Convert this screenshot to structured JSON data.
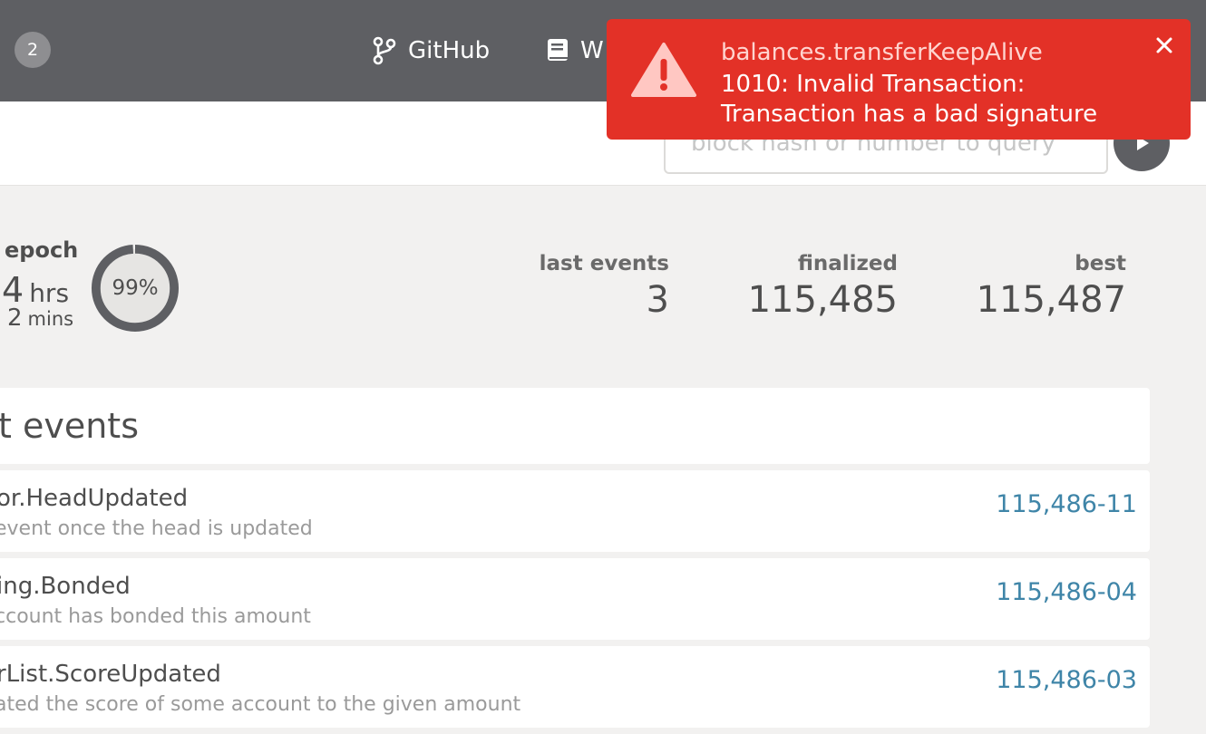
{
  "header": {
    "badge_count": "2",
    "nav": {
      "github_label": "GitHub",
      "wiki_label": "W"
    }
  },
  "query": {
    "placeholder": "block hash or number to query"
  },
  "summary": {
    "epoch": {
      "label": "epoch",
      "hours": "4",
      "hours_unit": "hrs",
      "minutes": "2",
      "minutes_unit": "mins",
      "progress_percent": 99,
      "progress_label": "99%"
    },
    "last_events": {
      "label": "last events",
      "value": "3"
    },
    "finalized": {
      "label": "finalized",
      "value": "115,485"
    },
    "best": {
      "label": "best",
      "value": "115,487"
    }
  },
  "events": {
    "title": "t events",
    "items": [
      {
        "name": "or.HeadUpdated",
        "description": "event once the head is updated",
        "block": "115,486-11"
      },
      {
        "name": "ing.Bonded",
        "description": "ccount has bonded this amount",
        "block": "115,486-04"
      },
      {
        "name": "rList.ScoreUpdated",
        "description": "ated the score of some account to the given amount",
        "block": "115,486-03"
      }
    ]
  },
  "toast": {
    "title": "balances.transferKeepAlive",
    "message_line1": "1010: Invalid Transaction:",
    "message_line2": "Transaction has a bad signature",
    "color": "#e33127"
  },
  "colors": {
    "topbar": "#5e5f63",
    "link": "#3f85a8",
    "background": "#f2f1f0"
  }
}
